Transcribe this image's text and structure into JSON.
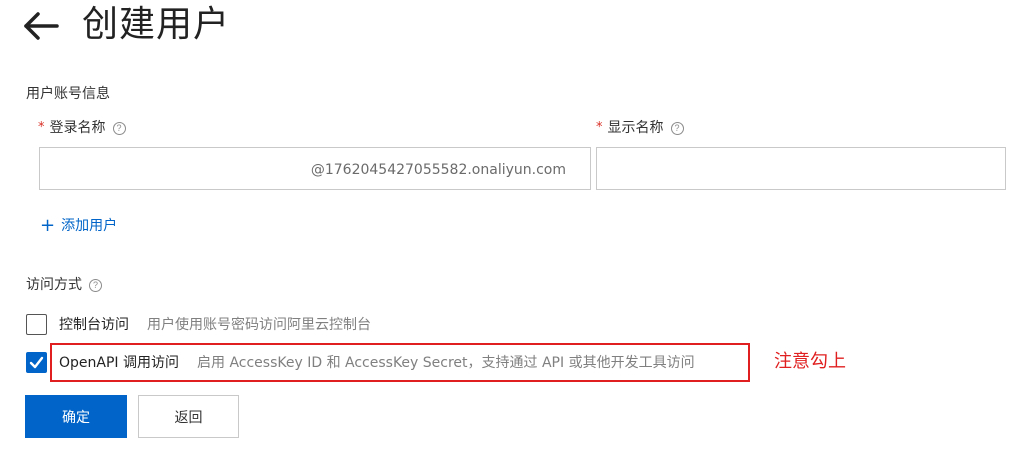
{
  "header": {
    "back_icon": "arrow-left-icon",
    "title": "创建用户"
  },
  "account_section": {
    "label": "用户账号信息",
    "login_name": {
      "required_mark": "*",
      "label": "登录名称",
      "help_icon": "question-circle-icon",
      "value": "",
      "suffix": "@1762045427055582.onaliyun.com"
    },
    "display_name": {
      "required_mark": "*",
      "label": "显示名称",
      "help_icon": "question-circle-icon",
      "value": ""
    },
    "add_user": {
      "icon": "plus-icon",
      "label": "添加用户"
    }
  },
  "access_section": {
    "label": "访问方式",
    "help_icon": "question-circle-icon",
    "options": [
      {
        "title": "控制台访问",
        "description": "用户使用账号密码访问阿里云控制台",
        "checked": false
      },
      {
        "title": "OpenAPI 调用访问",
        "description": "启用 AccessKey ID 和 AccessKey Secret，支持通过 API 或其他开发工具访问",
        "checked": true
      }
    ]
  },
  "annotation": {
    "note": "注意勾上",
    "color": "#e02020"
  },
  "actions": {
    "confirm_label": "确定",
    "back_label": "返回"
  },
  "colors": {
    "primary": "#0064c8",
    "required": "#d93026",
    "border": "#c9c9c9"
  }
}
